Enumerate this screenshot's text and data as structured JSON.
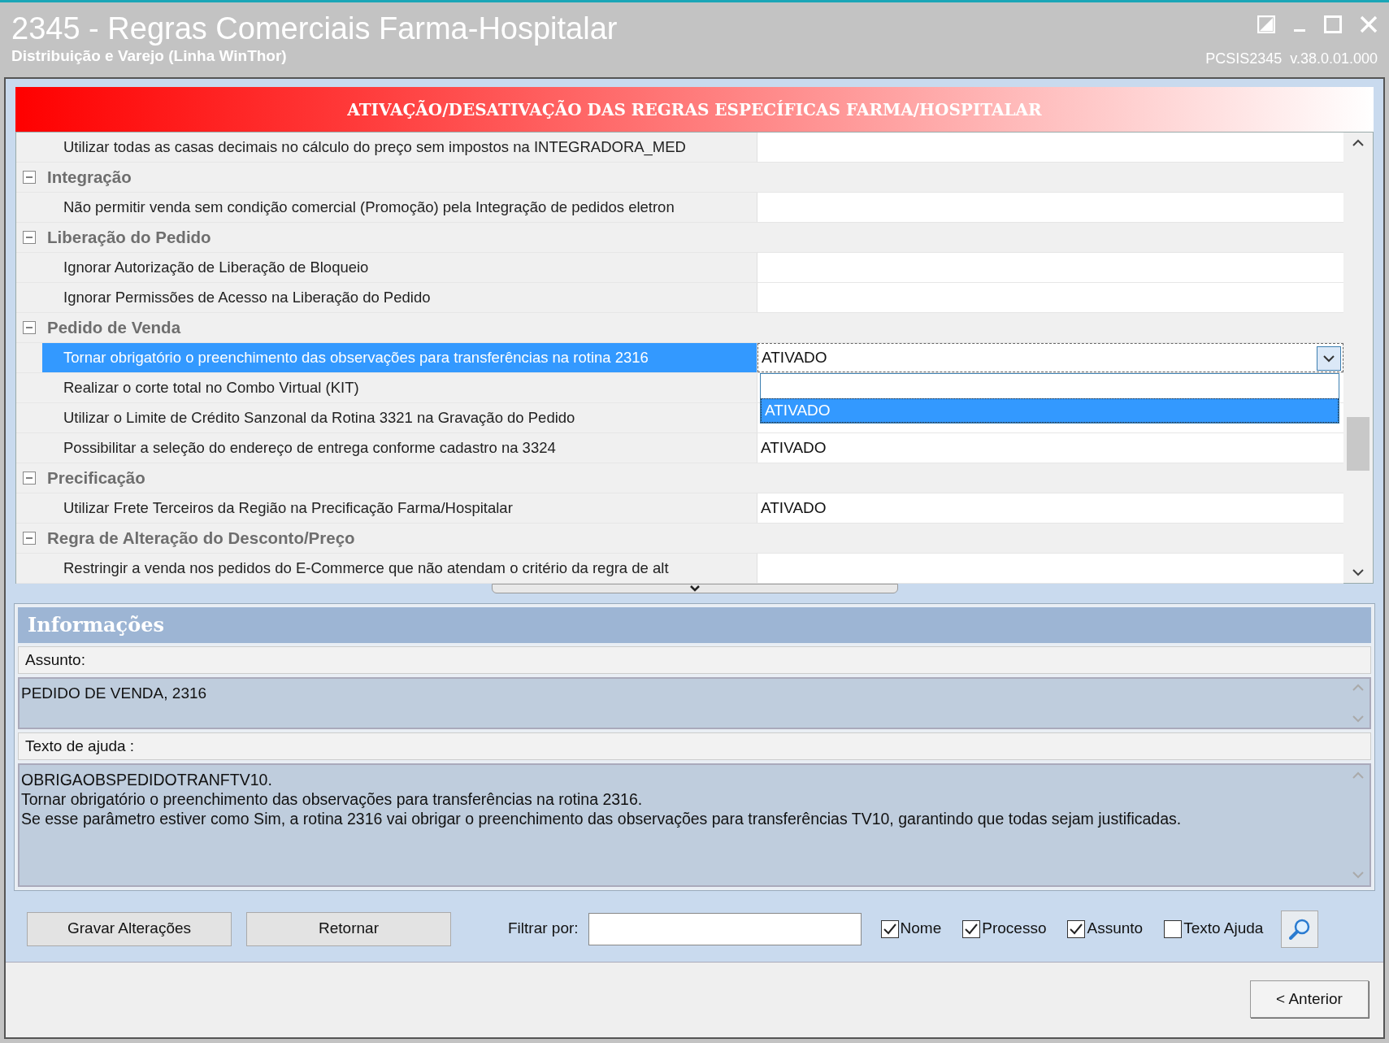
{
  "window": {
    "title": "2345 - Regras Comerciais Farma-Hospitalar",
    "subtitle": "Distribuição e Varejo (Linha WinThor)",
    "version": "PCSIS2345  v.38.0.01.000"
  },
  "banner": "ATIVAÇÃO/DESATIVAÇÃO DAS REGRAS ESPECÍFICAS FARMA/HOSPITALAR",
  "grid": {
    "rows": [
      {
        "kind": "item",
        "name": "Utilizar todas as casas decimais no cálculo do preço sem impostos na INTEGRADORA_MED",
        "selected": false
      },
      {
        "kind": "category",
        "name": "Integração",
        "expanded": true,
        "children": [
          {
            "kind": "item",
            "name": "Não permitir venda sem condição comercial (Promoção) pela Integração de pedidos eletron",
            "selected": false
          }
        ]
      },
      {
        "kind": "category",
        "name": "Liberação do Pedido",
        "expanded": true,
        "children": [
          {
            "kind": "item",
            "name": "Ignorar Autorização de Liberação de Bloqueio",
            "selected": false
          },
          {
            "kind": "item",
            "name": "Ignorar Permissões de Acesso na Liberação do Pedido",
            "selected": false
          }
        ]
      },
      {
        "kind": "category",
        "name": "Pedido de Venda",
        "expanded": true,
        "children": [
          {
            "kind": "item",
            "name": "Tornar obrigatório o preenchimento das observações para transferências na rotina 2316",
            "value": "ATIVADO",
            "selected": true,
            "dropdown_open": true,
            "options": [
              {
                "label": "ATIVADO",
                "selected": true
              }
            ]
          },
          {
            "kind": "item",
            "name": "Realizar o corte total no Combo Virtual (KIT)",
            "selected": false
          },
          {
            "kind": "item",
            "name": "Utilizar o Limite de Crédito Sanzonal da Rotina 3321 na Gravação do Pedido",
            "selected": false
          },
          {
            "kind": "item",
            "name": "Possibilitar a seleção do endereço de entrega conforme cadastro na 3324",
            "value": "ATIVADO",
            "selected": false
          }
        ]
      },
      {
        "kind": "category",
        "name": "Precificação",
        "expanded": true,
        "children": [
          {
            "kind": "item",
            "name": "Utilizar Frete Terceiros da Região na Precificação Farma/Hospitalar",
            "value": "ATIVADO",
            "selected": false
          }
        ]
      },
      {
        "kind": "category",
        "name": "Regra de Alteração do Desconto/Preço",
        "expanded": true,
        "children": [
          {
            "kind": "item",
            "name": "Restringir a venda nos pedidos do E-Commerce que não atendam o critério da regra de alt",
            "selected": false
          }
        ]
      }
    ]
  },
  "info": {
    "title": "Informações",
    "subject_label": "Assunto:",
    "subject": "PEDIDO DE VENDA, 2316",
    "help_label": "Texto de ajuda :",
    "help_lines": [
      "OBRIGAOBSPEDIDOTRANFTV10.",
      "Tornar obrigatório o preenchimento das observações para transferências na rotina 2316.",
      "Se esse parâmetro estiver como Sim, a rotina 2316 vai obrigar o preenchimento das observações para transferências TV10, garantindo que todas sejam justificadas."
    ]
  },
  "toolbar": {
    "buttons": [
      "Gravar Alterações",
      "Retornar"
    ],
    "filter_label": "Filtrar por:",
    "checkboxes": [
      {
        "label": "Nome",
        "checked": true
      },
      {
        "label": "Processo",
        "checked": true
      },
      {
        "label": "Assunto",
        "checked": true
      },
      {
        "label": "Texto Ajuda",
        "checked": false
      }
    ]
  },
  "footer": {
    "back_button": "< Anterior"
  }
}
